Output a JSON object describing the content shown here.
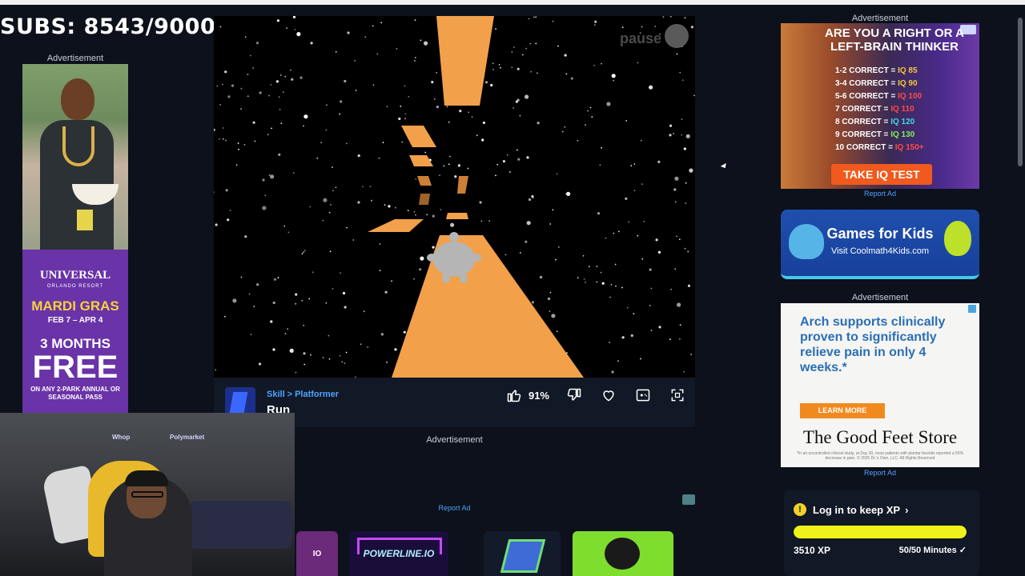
{
  "overlay": {
    "subs_text": "SUBS: 8543/9000"
  },
  "left_ad": {
    "label": "Advertisement",
    "brand": "UNIVERSAL",
    "brand_sub": "ORLANDO RESORT",
    "event": "MARDI GRAS",
    "dates": "FEB 7 – APR 4",
    "months": "3 MONTHS",
    "free": "FREE",
    "fine": "ON ANY 2-PARK ANNUAL OR SEASONAL PASS"
  },
  "game": {
    "pause_label": "pause",
    "breadcrumb": [
      "Skill",
      "Platformer"
    ],
    "title": "Run",
    "rating": "91%",
    "icons": [
      "thumbs-up-icon",
      "thumbs-down-icon",
      "heart-icon",
      "gamepad-icon",
      "fullscreen-icon"
    ]
  },
  "mid_ad": {
    "label": "Advertisement",
    "report": "Report Ad"
  },
  "thumbs": {
    "items": [
      {
        "name": "IO",
        "color": "#6b2a7a"
      },
      {
        "name": "POWERLINE.IO",
        "color": "#1a0d3a"
      },
      {
        "name": "",
        "color": "#131a2a"
      },
      {
        "name": "",
        "color": "#7fdd2e"
      }
    ]
  },
  "iq_ad": {
    "label": "Advertisement",
    "title": "ARE YOU A RIGHT OR A LEFT-BRAIN THINKER",
    "rows": [
      {
        "k": "1-2 CORRECT = ",
        "v": "IQ 85"
      },
      {
        "k": "3-4 CORRECT = ",
        "v": "IQ 90"
      },
      {
        "k": "5-6 CORRECT = ",
        "v": "IQ 100"
      },
      {
        "k": "7 CORRECT = ",
        "v": "IQ 110"
      },
      {
        "k": "8 CORRECT = ",
        "v": "IQ 120"
      },
      {
        "k": "9 CORRECT = ",
        "v": "IQ 130"
      },
      {
        "k": "10 CORRECT = ",
        "v": "IQ 150+"
      }
    ],
    "button": "TAKE IQ TEST",
    "report": "Report Ad"
  },
  "kids_ad": {
    "title": "Games for Kids",
    "sub": "Visit Coolmath4Kids.com"
  },
  "feet_ad": {
    "label": "Advertisement",
    "headline": "Arch supports clinically proven to significantly relieve pain in only 4 weeks.*",
    "button": "LEARN MORE",
    "brand": "The Good Feet Store",
    "fine": "*In an uncontrolled clinical study, at Day 30, most patients with plantar fasciitis reported a 50% decrease in pain. © 2025 Dr.'s Own, LLC. All Rights Reserved",
    "report": "Report Ad"
  },
  "xp": {
    "login": "Log in to keep XP",
    "value": "3510 XP",
    "minutes": "50/50 Minutes",
    "progress": 1.0,
    "bar_color": "#eef21a"
  }
}
